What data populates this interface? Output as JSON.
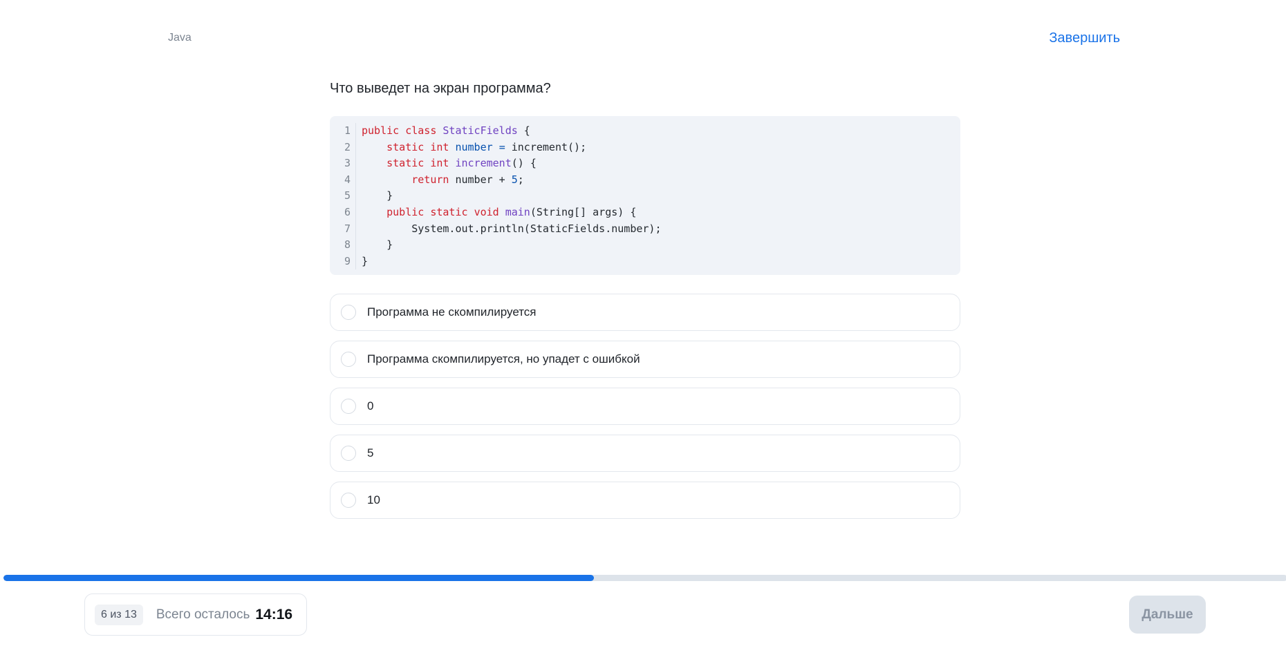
{
  "header": {
    "topic": "Java",
    "finish_label": "Завершить"
  },
  "question": {
    "text": "Что выведет на экран программа?",
    "code_lines": [
      {
        "n": "1",
        "text": "public class StaticFields {"
      },
      {
        "n": "2",
        "text": "    static int number = increment();"
      },
      {
        "n": "3",
        "text": "    static int increment() {"
      },
      {
        "n": "4",
        "text": "        return number + 5;"
      },
      {
        "n": "5",
        "text": "    }"
      },
      {
        "n": "6",
        "text": "    public static void main(String[] args) {"
      },
      {
        "n": "7",
        "text": "        System.out.println(StaticFields.number);"
      },
      {
        "n": "8",
        "text": "    }"
      },
      {
        "n": "9",
        "text": "}"
      }
    ]
  },
  "options": [
    {
      "label": "Программа не скомпилируется"
    },
    {
      "label": "Программа скомпилируется, но упадет с ошибкой"
    },
    {
      "label": "0"
    },
    {
      "label": "5"
    },
    {
      "label": "10"
    }
  ],
  "progress": {
    "current": 6,
    "total": 13,
    "fraction": 0.46,
    "fill_color": "#1a73e8",
    "track_color": "#dde3ea"
  },
  "footer": {
    "counter_label": "6 из 13",
    "remaining_label": "Всего осталось",
    "timer": "14:16",
    "next_label": "Дальше"
  },
  "colors": {
    "accent": "#1a73e8",
    "code_background": "#f0f3f8",
    "keyword": "#cf222e",
    "class_name": "#6f42c1",
    "variable": "#0550ae"
  }
}
